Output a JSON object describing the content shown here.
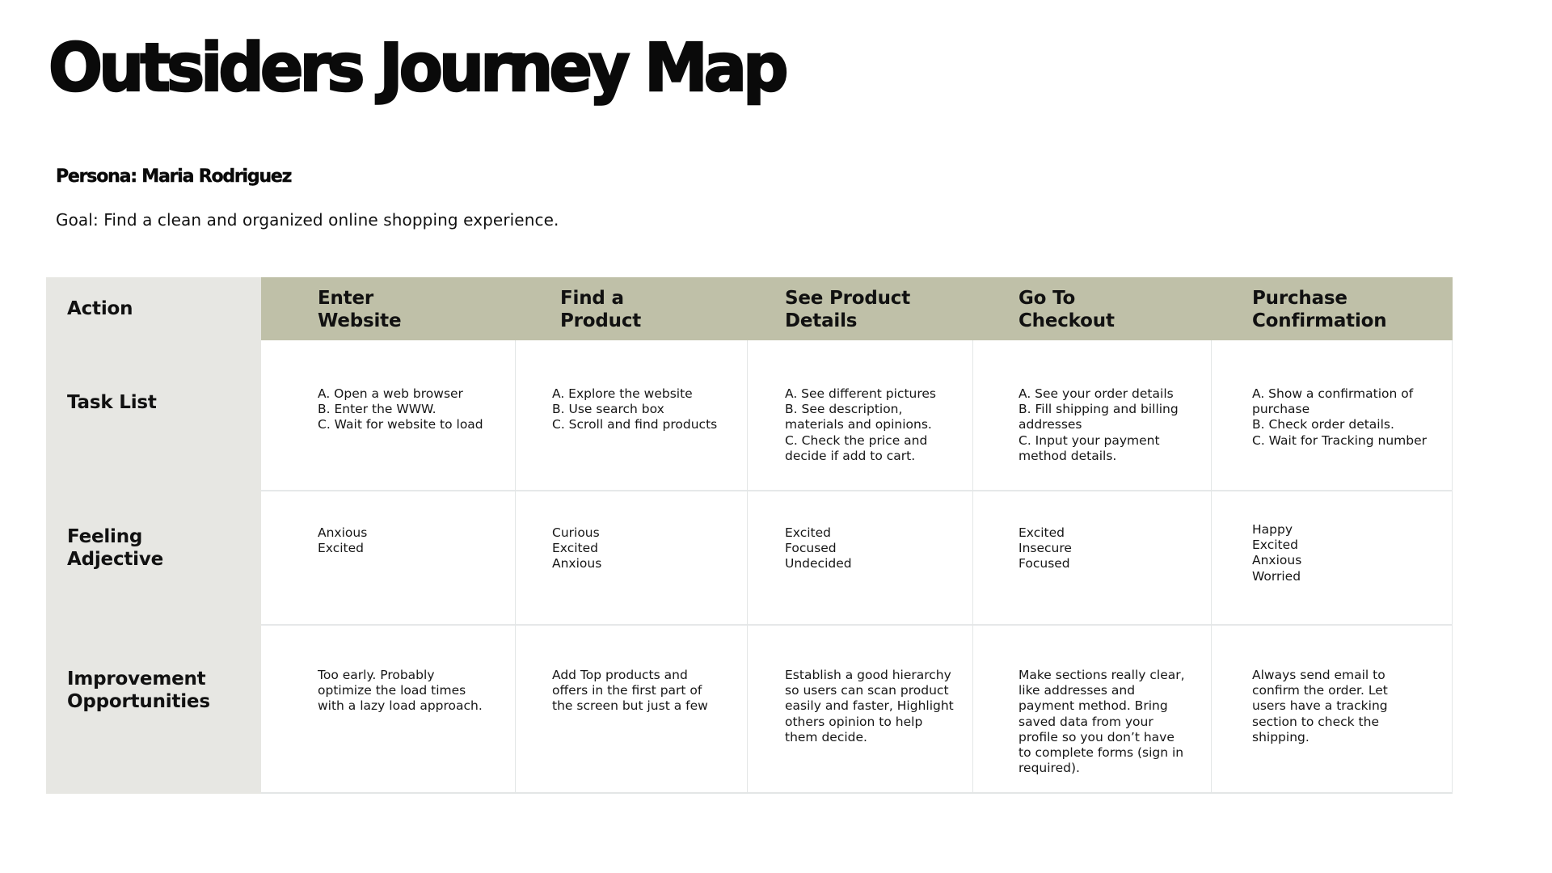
{
  "title": "Outsiders Journey Map",
  "persona": "Persona: Maria Rodriguez",
  "goal": "Goal: Find a clean and organized online shopping experience.",
  "colors": {
    "label_column_bg": "#e7e7e3",
    "header_band_bg": "#bfc0a8",
    "grid_line": "#e3e6e6"
  },
  "row_labels": {
    "action": "Action",
    "task_list": "Task List",
    "feeling": "Feeling\nAdjective",
    "improvement": "Improvement\nOpportunities"
  },
  "stages": [
    {
      "header": "Enter\nWebsite",
      "tasks": "A. Open a web browser\nB. Enter the WWW.\nC. Wait for website to load",
      "feelings": "Anxious\nExcited",
      "improvement": "Too early. Probably\noptimize the load times\nwith a lazy load approach."
    },
    {
      "header": "Find a\nProduct",
      "tasks": "A. Explore the website\nB. Use search box\nC. Scroll and find products",
      "feelings": "Curious\nExcited\nAnxious",
      "improvement": "Add Top products and\noffers in the first part of\nthe screen but just a few"
    },
    {
      "header": "See Product\nDetails",
      "tasks": "A. See different pictures\nB. See description,\nmaterials and opinions.\nC. Check the price and\ndecide if add to cart.",
      "feelings": "Excited\nFocused\nUndecided",
      "improvement": "Establish a good hierarchy\nso users can scan product\neasily and faster, Highlight\nothers opinion to help\nthem decide."
    },
    {
      "header": "Go To\nCheckout",
      "tasks": "A. See your order details\nB. Fill shipping and billing\naddresses\nC. Input your payment\nmethod details.",
      "feelings": "Excited\nInsecure\nFocused",
      "improvement": "Make sections really clear,\nlike addresses and\npayment method. Bring\nsaved data from your\nprofile so you don’t have\nto complete forms (sign in\nrequired)."
    },
    {
      "header": "Purchase\nConfirmation",
      "tasks": "A. Show a confirmation of\npurchase\nB. Check order details.\nC. Wait for Tracking number",
      "feelings": "Happy\nExcited\nAnxious\nWorried",
      "improvement": "Always send email to\nconfirm the order. Let\nusers have a tracking\nsection to check the\nshipping."
    }
  ]
}
